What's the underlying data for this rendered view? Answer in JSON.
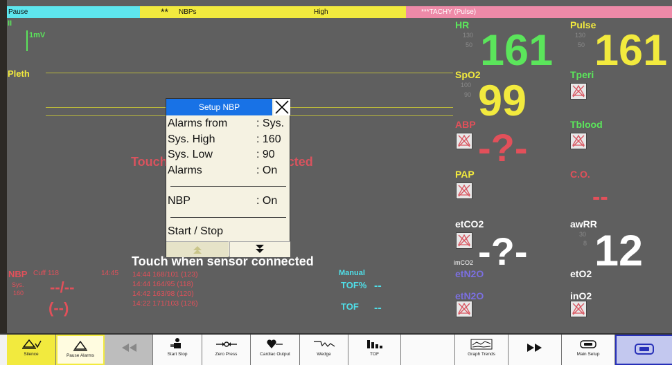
{
  "status_bar": {
    "pause_label": "Pause",
    "alarm_stars": "**",
    "alarm_param": "NBPs",
    "alarm_level": "High",
    "tachy_label": "***TACHY (Pulse)"
  },
  "left_labels": {
    "lead": "II",
    "scale": "1mV",
    "pleth": "Pleth"
  },
  "touch_msg": "Touch when sensor connected",
  "dialog": {
    "title": "Setup NBP",
    "rows": [
      {
        "k": "Alarms from",
        "v": ": Sys."
      },
      {
        "k": "Sys. High",
        "v": ": 160"
      },
      {
        "k": "Sys. Low",
        "v": ": 90"
      },
      {
        "k": "Alarms",
        "v": ": On"
      }
    ],
    "nbp_label": "NBP",
    "nbp_value": ": On",
    "start_stop": "Start / Stop"
  },
  "nbp_panel": {
    "label": "NBP",
    "cuff": "Cuff 118",
    "time": "14:45",
    "sys_label": "Sys.",
    "sys_value": "160",
    "main_value": "--/--",
    "mean_value": "(--)",
    "history": [
      "14:44 168/101 (123)",
      "14:44 164/95 (118)",
      "14:42 163/98 (120)",
      "14:22 171/103 (126)"
    ]
  },
  "tof_panel": {
    "manual": "Manual",
    "tof_pct_label": "TOF%",
    "tof_pct_value": "--",
    "tof_label": "TOF",
    "tof_value": "--"
  },
  "params": {
    "hr": {
      "label": "HR",
      "value": "161",
      "hi": "130",
      "lo": "50"
    },
    "pulse": {
      "label": "Pulse",
      "value": "161",
      "hi": "130",
      "lo": "50"
    },
    "spo2": {
      "label": "SpO2",
      "value": "99",
      "hi": "100",
      "lo": "90"
    },
    "tperi": {
      "label": "Tperi"
    },
    "abp": {
      "label": "ABP",
      "value": "-?-"
    },
    "tblood": {
      "label": "Tblood"
    },
    "pap": {
      "label": "PAP"
    },
    "co": {
      "label": "C.O.",
      "value": "--"
    },
    "etco2": {
      "label": "etCO2",
      "value": "-?-",
      "imco2": "imCO2"
    },
    "awrr": {
      "label": "awRR",
      "value": "12",
      "hi": "30",
      "lo": "8"
    },
    "etn2o": {
      "label": "etN2O"
    },
    "eto2": {
      "label": "etO2"
    },
    "etx": {
      "label": "etN2O"
    },
    "ino2": {
      "label": "inO2"
    }
  },
  "toolbar": [
    {
      "name": "silence",
      "label": "Silence"
    },
    {
      "name": "pause-alarms",
      "label": "Pause Alarms"
    },
    {
      "name": "prev",
      "label": ""
    },
    {
      "name": "start-stop",
      "label": "Start Stop"
    },
    {
      "name": "zero-press",
      "label": "Zero Press"
    },
    {
      "name": "cardiac-output",
      "label": "Cardiac Output"
    },
    {
      "name": "wedge",
      "label": "Wedge"
    },
    {
      "name": "tof",
      "label": "TOF"
    },
    {
      "name": "blank",
      "label": ""
    },
    {
      "name": "graph-trends",
      "label": "Graph Trends"
    },
    {
      "name": "next",
      "label": ""
    },
    {
      "name": "main-setup",
      "label": "Main Setup"
    },
    {
      "name": "monitor",
      "label": ""
    }
  ]
}
